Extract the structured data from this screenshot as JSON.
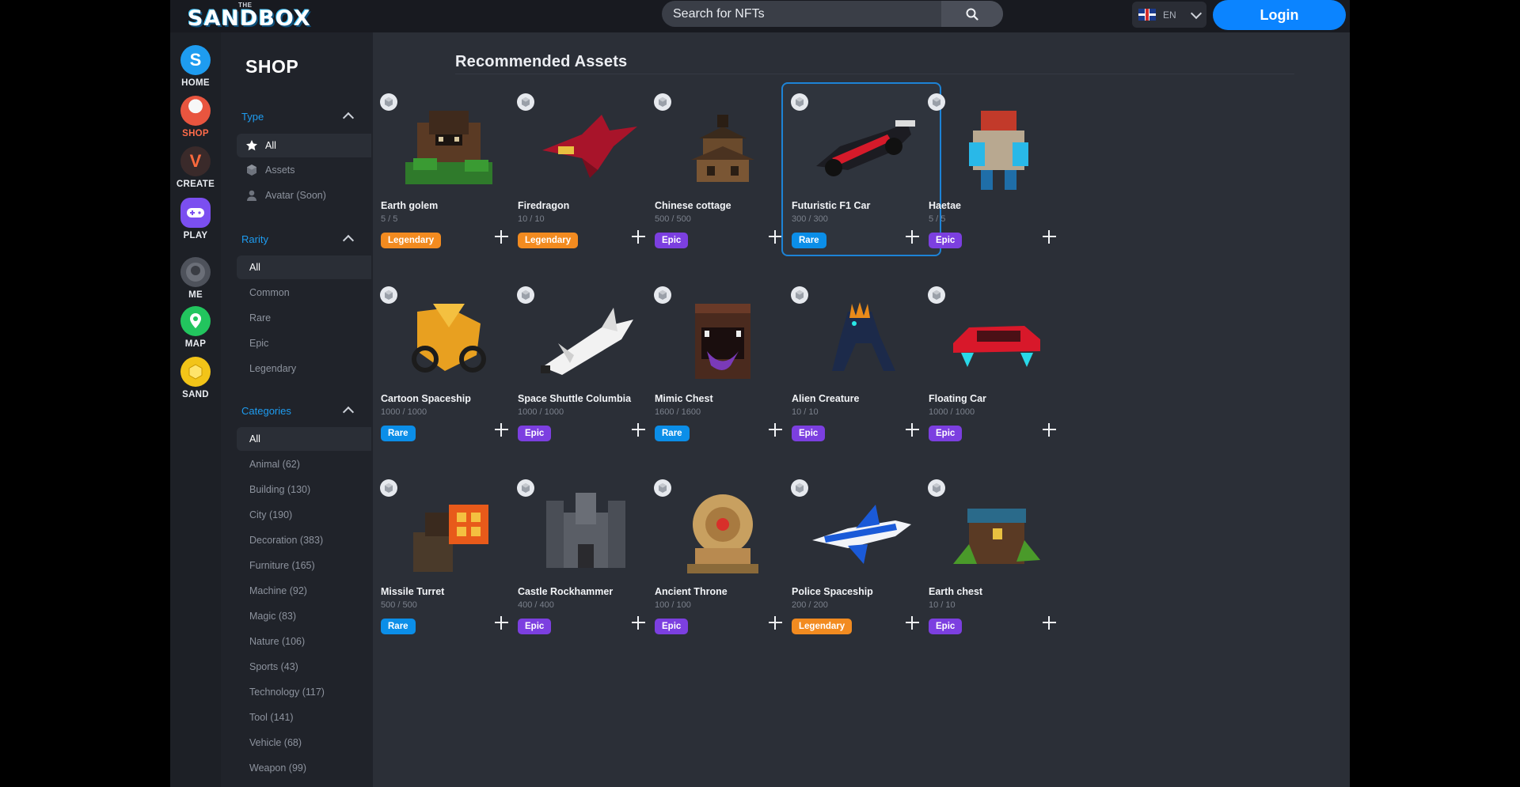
{
  "header": {
    "logo_small": "THE",
    "logo_main": "SANDBOX",
    "search_placeholder": "Search for NFTs",
    "language": "EN",
    "login_label": "Login"
  },
  "nav": [
    {
      "label": "HOME",
      "icon": "home-icon",
      "glyph": "S",
      "color": "#1e9cf0"
    },
    {
      "label": "SHOP",
      "icon": "shop-icon",
      "glyph": "",
      "color": "#e8553f"
    },
    {
      "label": "CREATE",
      "icon": "create-icon",
      "glyph": "V",
      "color": "#3a2a2a"
    },
    {
      "label": "PLAY",
      "icon": "play-icon",
      "glyph": "",
      "color": "#7b4ff0"
    },
    {
      "label": "ME",
      "icon": "me-icon",
      "glyph": "",
      "color": "#4e525b"
    },
    {
      "label": "MAP",
      "icon": "map-icon",
      "glyph": "",
      "color": "#22c55e"
    },
    {
      "label": "SAND",
      "icon": "sand-icon",
      "glyph": "",
      "color": "#f2c418"
    }
  ],
  "sidebar": {
    "title": "SHOP",
    "type": {
      "heading": "Type",
      "options": [
        "All",
        "Assets",
        "Avatar (Soon)"
      ]
    },
    "rarity": {
      "heading": "Rarity",
      "options": [
        "All",
        "Common",
        "Rare",
        "Epic",
        "Legendary"
      ]
    },
    "categories": {
      "heading": "Categories",
      "options": [
        "All",
        "Animal (62)",
        "Building (130)",
        "City (190)",
        "Decoration (383)",
        "Furniture (165)",
        "Machine (92)",
        "Magic (83)",
        "Nature (106)",
        "Sports (43)",
        "Technology (117)",
        "Tool (141)",
        "Vehicle (68)",
        "Weapon (99)"
      ]
    }
  },
  "main": {
    "title": "Recommended Assets",
    "assets": [
      {
        "name": "Earth golem",
        "qty": "5 / 5",
        "rarity": "Legendary"
      },
      {
        "name": "Firedragon",
        "qty": "10 / 10",
        "rarity": "Legendary"
      },
      {
        "name": "Chinese cottage",
        "qty": "500 / 500",
        "rarity": "Epic"
      },
      {
        "name": "Futuristic F1 Car",
        "qty": "300 / 300",
        "rarity": "Rare"
      },
      {
        "name": "Haetae",
        "qty": "5 / 5",
        "rarity": "Epic"
      },
      {
        "name": "Cartoon Spaceship",
        "qty": "1000 / 1000",
        "rarity": "Rare"
      },
      {
        "name": "Space Shuttle Columbia",
        "qty": "1000 / 1000",
        "rarity": "Epic"
      },
      {
        "name": "Mimic Chest",
        "qty": "1600 / 1600",
        "rarity": "Rare"
      },
      {
        "name": "Alien Creature",
        "qty": "10 / 10",
        "rarity": "Epic"
      },
      {
        "name": "Floating Car",
        "qty": "1000 / 1000",
        "rarity": "Epic"
      },
      {
        "name": "Missile Turret",
        "qty": "500 / 500",
        "rarity": "Rare"
      },
      {
        "name": "Castle Rockhammer",
        "qty": "400 / 400",
        "rarity": "Epic"
      },
      {
        "name": "Ancient Throne",
        "qty": "100 / 100",
        "rarity": "Epic"
      },
      {
        "name": "Police Spaceship",
        "qty": "200 / 200",
        "rarity": "Legendary"
      },
      {
        "name": "Earth chest",
        "qty": "10 / 10",
        "rarity": "Epic"
      }
    ]
  },
  "rarity_colors": {
    "Legendary": "#f28b20",
    "Epic": "#7c3fe0",
    "Rare": "#0b8ee8"
  }
}
